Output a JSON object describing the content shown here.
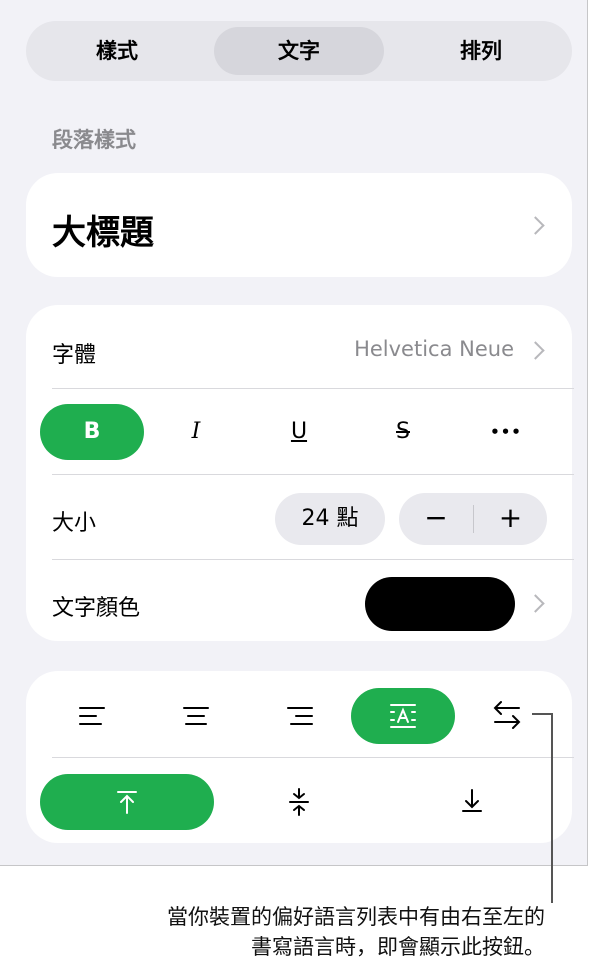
{
  "tabs": [
    {
      "label": "樣式",
      "active": false
    },
    {
      "label": "文字",
      "active": true
    },
    {
      "label": "排列",
      "active": false
    }
  ],
  "paragraph_section_label": "段落樣式",
  "paragraph_style": "大標題",
  "font": {
    "label": "字體",
    "value": "Helvetica Neue"
  },
  "format_buttons": {
    "bold": "B",
    "italic": "I",
    "underline": "U",
    "strike": "S",
    "more": "•••"
  },
  "size": {
    "label": "大小",
    "value": "24 點",
    "decrease": "−",
    "increase": "+"
  },
  "text_color": {
    "label": "文字顏色",
    "value_color": "#000000"
  },
  "accent_color": "#1fae4f",
  "alignment_icons": [
    "align-left-icon",
    "align-center-icon",
    "align-right-icon",
    "justify-text-icon",
    "text-direction-icon"
  ],
  "vertical_icons": [
    "align-top-icon",
    "align-middle-icon",
    "align-bottom-icon"
  ],
  "callout": {
    "line1": "當你裝置的偏好語言列表中有由右至左的",
    "line2": "書寫語言時，即會顯示此按鈕。"
  }
}
